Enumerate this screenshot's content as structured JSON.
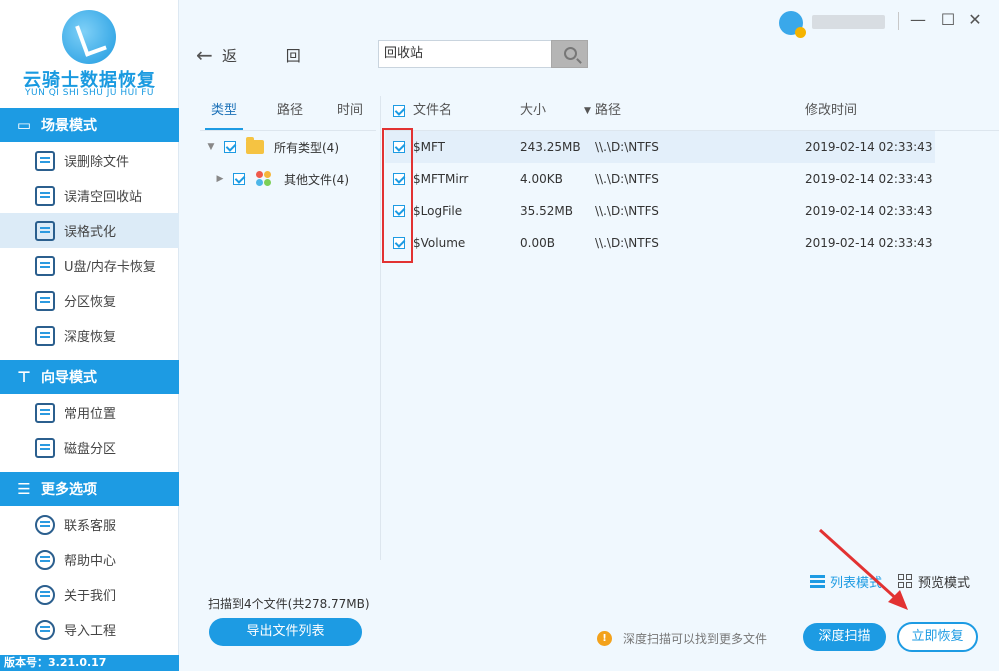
{
  "app": {
    "title": "云骑士数据恢复",
    "subtitle": "YUN QI SHI SHU JU HUI FU",
    "version": "版本号：3.21.0.17"
  },
  "window": {
    "min": "—",
    "max": "☐",
    "close": "✕"
  },
  "sidebar": {
    "scene_mode": "场景模式",
    "scene_items": [
      {
        "label": "误删除文件",
        "icon": "deleted-file-icon"
      },
      {
        "label": "误清空回收站",
        "icon": "recycle-bin-icon"
      },
      {
        "label": "误格式化",
        "icon": "format-icon"
      },
      {
        "label": "U盘/内存卡恢复",
        "icon": "usb-icon"
      },
      {
        "label": "分区恢复",
        "icon": "partition-icon"
      },
      {
        "label": "深度恢复",
        "icon": "deep-recovery-icon"
      }
    ],
    "guide_mode": "向导模式",
    "guide_items": [
      {
        "label": "常用位置",
        "icon": "common-location-icon"
      },
      {
        "label": "磁盘分区",
        "icon": "disk-partition-icon"
      }
    ],
    "more_options": "更多选项",
    "more_items": [
      {
        "label": "联系客服",
        "icon": "support-icon"
      },
      {
        "label": "帮助中心",
        "icon": "help-icon"
      },
      {
        "label": "关于我们",
        "icon": "about-icon"
      },
      {
        "label": "导入工程",
        "icon": "import-icon"
      }
    ]
  },
  "nav": {
    "back": "返 回",
    "search_value": "回收站"
  },
  "type_panel": {
    "tabs": [
      "类型",
      "路径",
      "时间"
    ],
    "tree": [
      {
        "label": "所有类型(4)"
      },
      {
        "label": "其他文件(4)"
      }
    ]
  },
  "table": {
    "headers": {
      "name": "文件名",
      "size": "大小",
      "path": "路径",
      "modified": "修改时间"
    },
    "rows": [
      {
        "name": "$MFT",
        "size": "243.25MB",
        "path": "\\\\.\\D:\\NTFS",
        "modified": "2019-02-14 02:33:43"
      },
      {
        "name": "$MFTMirr",
        "size": "4.00KB",
        "path": "\\\\.\\D:\\NTFS",
        "modified": "2019-02-14 02:33:43"
      },
      {
        "name": "$LogFile",
        "size": "35.52MB",
        "path": "\\\\.\\D:\\NTFS",
        "modified": "2019-02-14 02:33:43"
      },
      {
        "name": "$Volume",
        "size": "0.00B",
        "path": "\\\\.\\D:\\NTFS",
        "modified": "2019-02-14 02:33:43"
      }
    ]
  },
  "bottom": {
    "list_mode": "列表模式",
    "preview_mode": "预览模式",
    "scan_summary": "扫描到4个文件(共278.77MB)",
    "export_button": "导出文件列表",
    "tip": "深度扫描可以找到更多文件",
    "deep_scan_button": "深度扫描",
    "recover_button": "立即恢复"
  },
  "colors": {
    "accent": "#1d9be3",
    "highlight_box": "#e23232",
    "warning": "#f3a21c"
  }
}
